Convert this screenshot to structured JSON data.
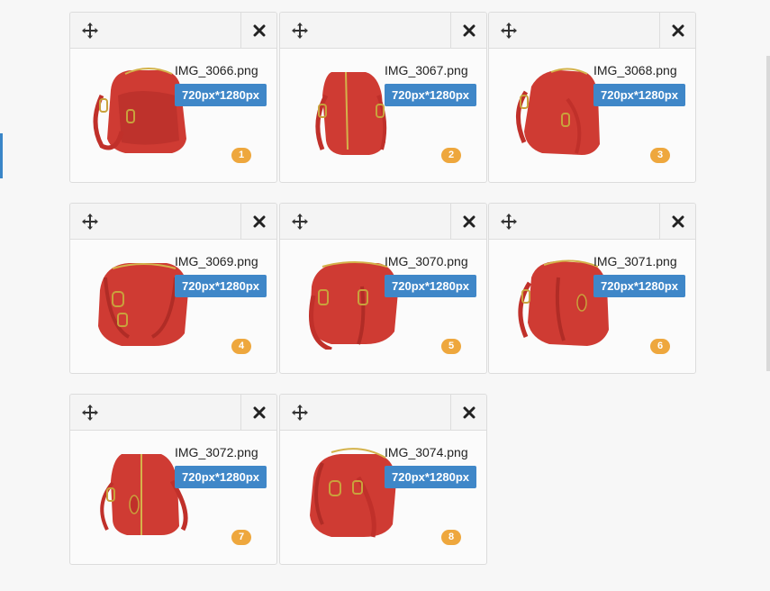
{
  "images": [
    {
      "filename": "IMG_3066.png",
      "dimensions": "720px*1280px",
      "order": "1"
    },
    {
      "filename": "IMG_3067.png",
      "dimensions": "720px*1280px",
      "order": "2"
    },
    {
      "filename": "IMG_3068.png",
      "dimensions": "720px*1280px",
      "order": "3"
    },
    {
      "filename": "IMG_3069.png",
      "dimensions": "720px*1280px",
      "order": "4"
    },
    {
      "filename": "IMG_3070.png",
      "dimensions": "720px*1280px",
      "order": "5"
    },
    {
      "filename": "IMG_3071.png",
      "dimensions": "720px*1280px",
      "order": "6"
    },
    {
      "filename": "IMG_3072.png",
      "dimensions": "720px*1280px",
      "order": "7"
    },
    {
      "filename": "IMG_3074.png",
      "dimensions": "720px*1280px",
      "order": "8"
    }
  ],
  "icons": {
    "move": "move-arrows-icon",
    "close": "close-x-icon"
  },
  "colors": {
    "badge_blue": "#3f87c8",
    "number_orange": "#eea73d",
    "bag_red": "#cf3b33"
  }
}
